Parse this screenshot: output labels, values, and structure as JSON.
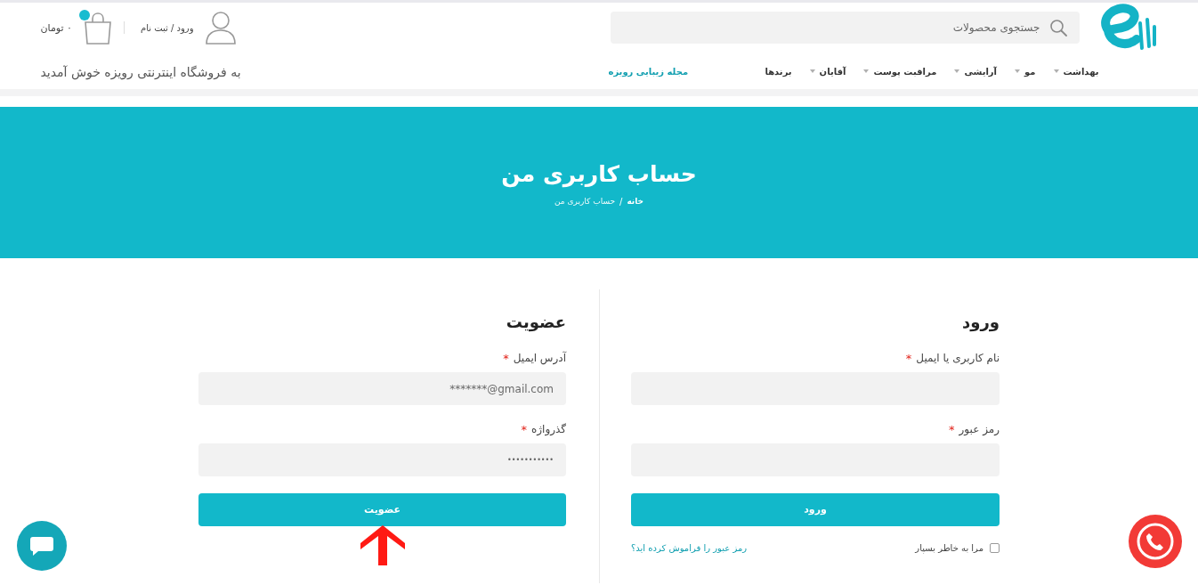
{
  "header": {
    "search": {
      "placeholder": "جستجوی محصولات"
    },
    "account_link": "ورود / ثبت نام",
    "cart": {
      "total": "۰ تومان"
    },
    "nav": [
      {
        "label": "بهداشت",
        "dropdown": true
      },
      {
        "label": "مو",
        "dropdown": true
      },
      {
        "label": "آرایشی",
        "dropdown": true
      },
      {
        "label": "مراقبت پوست",
        "dropdown": true
      },
      {
        "label": "آقایان",
        "dropdown": true
      },
      {
        "label": "برندها",
        "dropdown": false
      }
    ],
    "featured_link": "مجله زیبایی رویزه",
    "welcome": "به فروشگاه اینترنتی رویزه خوش آمدید"
  },
  "banner": {
    "title": "حساب کاربری من",
    "breadcrumb": [
      "خانه",
      "حساب کاربری من"
    ],
    "breadcrumb_separator": "/"
  },
  "login": {
    "title": "ورود",
    "fields": [
      {
        "label": "نام کاربری یا ایمیل",
        "required_mark": "*"
      },
      {
        "label": "رمز عبور",
        "required_mark": "*"
      }
    ],
    "button": "ورود",
    "remember": {
      "label": "مرا به خاطر بسپار",
      "checked": false
    },
    "lost_password": "رمز عبور را فراموش کرده اید؟"
  },
  "register": {
    "title": "عضویت",
    "fields": [
      {
        "label": "آدرس ایمیل",
        "required_mark": "*",
        "value": "*******@gmail.com",
        "kind": "email"
      },
      {
        "label": "گذرواژه",
        "required_mark": "*",
        "value": "•••••••••••",
        "kind": "password"
      }
    ],
    "button": "عضویت"
  }
}
